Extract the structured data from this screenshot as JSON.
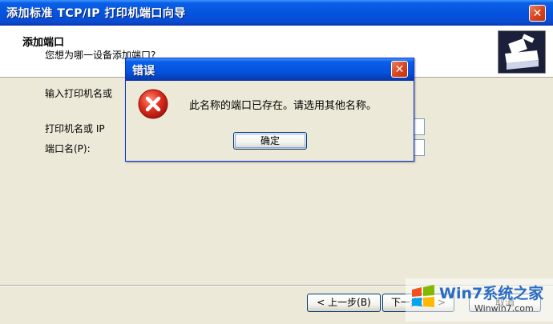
{
  "wizard": {
    "title": "添加标准 TCP/IP 打印机端口向导",
    "close_glyph": "✕",
    "header_title": "添加端口",
    "header_subtitle": "您想为哪一设备添加端口?",
    "instruction": "输入打印机名或",
    "printer_name_label": "打印机名或 IP",
    "port_name_label": "端口名(P):",
    "back_button": "< 上一步(B)",
    "next_button": "下一步(N) >",
    "cancel_button": "取消"
  },
  "error_dialog": {
    "title": "错误",
    "close_glyph": "✕",
    "message": "此名称的端口已存在。请选用其他名称。",
    "ok_button": "确定"
  },
  "watermark": {
    "brand": "Win7系统之家",
    "url": "Winwin7.com"
  },
  "colors": {
    "title_blue": "#0553dd",
    "close_red": "#d6431e",
    "dialog_bg": "#ece9d8",
    "error_red": "#d0281c"
  }
}
